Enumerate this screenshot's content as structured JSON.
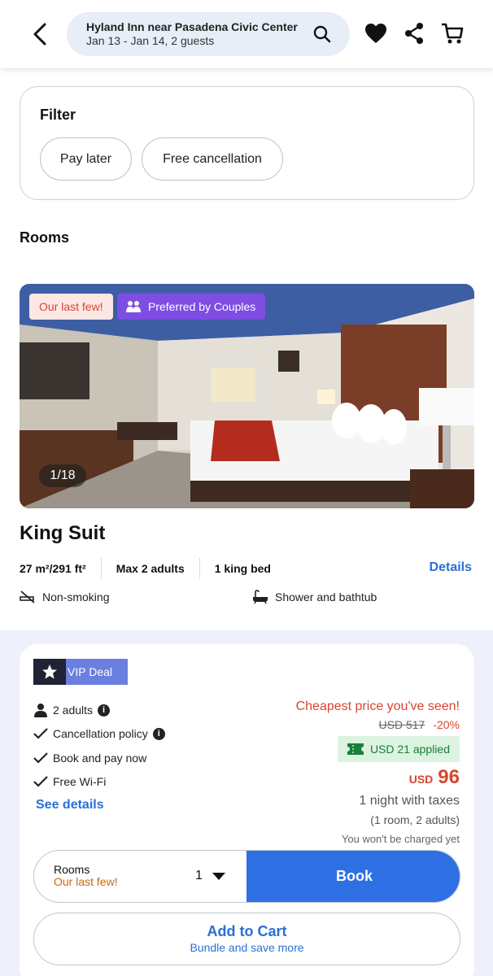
{
  "header": {
    "hotel": "Hyland Inn near Pasadena Civic Center",
    "dates_guests": "Jan 13 - Jan 14, 2 guests"
  },
  "filter": {
    "title": "Filter",
    "chips": [
      "Pay later",
      "Free cancellation"
    ]
  },
  "rooms_title": "Rooms",
  "photo": {
    "badge_last_few": "Our last few!",
    "badge_couples": "Preferred by Couples",
    "counter": "1/18"
  },
  "room": {
    "name": "King Suit",
    "size": "27 m²/291 ft²",
    "occupancy": "Max 2 adults",
    "bed": "1 king bed",
    "details_link": "Details",
    "amenities": [
      "Non-smoking",
      "Shower and bathtub"
    ]
  },
  "deal": {
    "vip_label": "VIP Deal",
    "features": [
      "2 adults",
      "Cancellation policy",
      "Book and pay now",
      "Free Wi-Fi"
    ],
    "see_details": "See details",
    "cheapest": "Cheapest price you've seen!",
    "original_price": "USD 517",
    "discount": "-20%",
    "applied": "USD 21 applied",
    "currency": "USD",
    "price": "96",
    "night": "1 night with taxes",
    "room_adults": "(1 room, 2 adults)",
    "no_charge": "You won't be charged yet"
  },
  "selector": {
    "label": "Rooms",
    "sublabel": "Our last few!",
    "quantity": "1",
    "book": "Book"
  },
  "cart": {
    "label": "Add to Cart",
    "sublabel": "Bundle and save more"
  },
  "colors": {
    "accent": "#2f6fe4",
    "link": "#2b6fd6",
    "price_red": "#d9452f",
    "vip": "#6b7fe0",
    "couples": "#7e4de3",
    "applied_bg": "#dcf3e0"
  }
}
